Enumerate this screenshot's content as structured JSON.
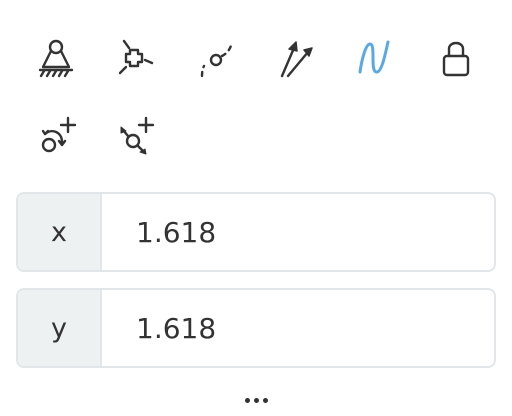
{
  "toolbar": {
    "accent_color": "#5aa9e6",
    "icon_color": "#333333",
    "tools": [
      {
        "icon": "fixed-support-icon",
        "active": false
      },
      {
        "icon": "point-on-object-icon",
        "active": false
      },
      {
        "icon": "point-on-curve-icon",
        "active": false
      },
      {
        "icon": "vector-arrows-icon",
        "active": false
      },
      {
        "icon": "freehand-curve-icon",
        "active": true
      },
      {
        "icon": "lock-icon",
        "active": false
      },
      {
        "icon": "add-rotation-icon",
        "active": false
      },
      {
        "icon": "add-translation-icon",
        "active": false
      }
    ]
  },
  "fields": {
    "x": {
      "label": "x",
      "value": "1.618"
    },
    "y": {
      "label": "y",
      "value": "1.618"
    }
  },
  "more_icon": "ellipsis-icon"
}
